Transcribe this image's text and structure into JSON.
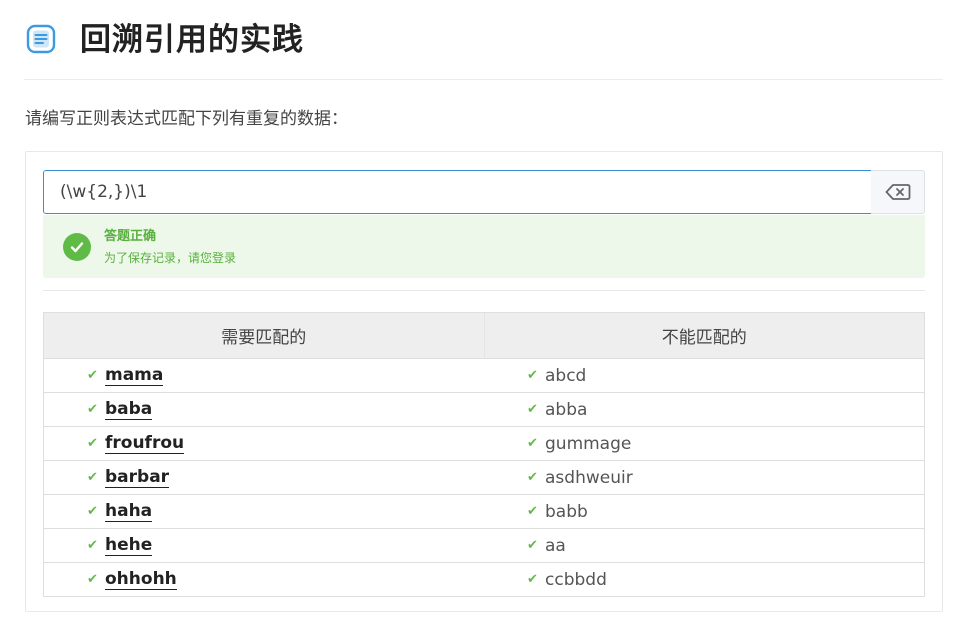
{
  "page": {
    "title": "回溯引用的实践",
    "prompt": "请编写正则表达式匹配下列有重复的数据："
  },
  "regex": {
    "value": "(\\w{2,})\\1"
  },
  "feedback": {
    "title": "答题正确",
    "subtitle": "为了保存记录，请您登录"
  },
  "table": {
    "headers": [
      "需要匹配的",
      "不能匹配的"
    ],
    "rows": [
      {
        "match": "mama",
        "nomatch": "abcd"
      },
      {
        "match": "baba",
        "nomatch": "abba"
      },
      {
        "match": "froufrou",
        "nomatch": "gummage"
      },
      {
        "match": "barbar",
        "nomatch": "asdhweuir"
      },
      {
        "match": "haha",
        "nomatch": "babb"
      },
      {
        "match": "hehe",
        "nomatch": "aa"
      },
      {
        "match": "ohhohh",
        "nomatch": "ccbbdd"
      }
    ]
  },
  "colors": {
    "accent": "#3b8fd0",
    "success": "#5fbb46",
    "success_bg": "#edf8ea"
  },
  "icons": {
    "header": "document-icon",
    "clear": "backspace-icon",
    "status": "check-circle-icon",
    "row_mark": "check-icon"
  }
}
